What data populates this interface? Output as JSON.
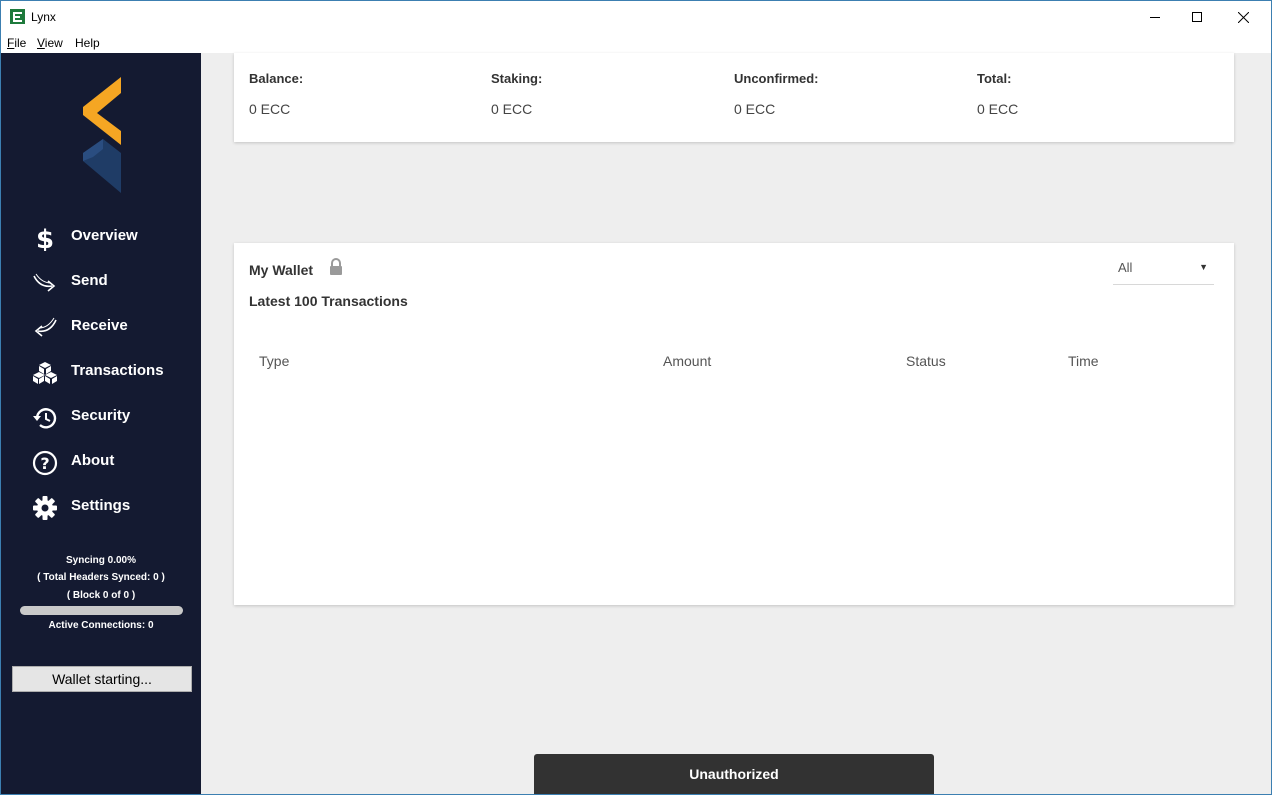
{
  "window": {
    "title": "Lynx"
  },
  "menu": [
    {
      "key": "F",
      "rest": "ile"
    },
    {
      "key": "V",
      "rest": "iew"
    },
    {
      "key": "",
      "rest": "Help"
    }
  ],
  "sidebar": {
    "items": [
      {
        "label": "Overview",
        "icon": "dollar-icon"
      },
      {
        "label": "Send",
        "icon": "send-arrow-icon"
      },
      {
        "label": "Receive",
        "icon": "receive-arrow-icon"
      },
      {
        "label": "Transactions",
        "icon": "cubes-icon"
      },
      {
        "label": "Security",
        "icon": "history-icon"
      },
      {
        "label": "About",
        "icon": "question-icon"
      },
      {
        "label": "Settings",
        "icon": "gear-icon"
      }
    ],
    "sync": {
      "status": "Syncing 0.00%",
      "headers": "( Total Headers Synced: 0 )",
      "block": "( Block 0 of 0 )",
      "connections": "Active Connections: 0",
      "progress_percent": 0
    },
    "wallet_button": "Wallet starting..."
  },
  "balances": [
    {
      "label": "Balance:",
      "value": "0 ECC"
    },
    {
      "label": "Staking:",
      "value": "0 ECC"
    },
    {
      "label": "Unconfirmed:",
      "value": "0 ECC"
    },
    {
      "label": "Total:",
      "value": "0 ECC"
    }
  ],
  "wallet": {
    "title": "My Wallet",
    "subtitle": "Latest 100 Transactions",
    "filter": "All",
    "columns": [
      "Type",
      "Amount",
      "Status",
      "Time"
    ]
  },
  "toast": "Unauthorized",
  "colors": {
    "sidebar_bg": "#141a31",
    "logo_orange": "#f5a623",
    "logo_blue": "#1f3c66",
    "toast_bg": "#323232"
  }
}
